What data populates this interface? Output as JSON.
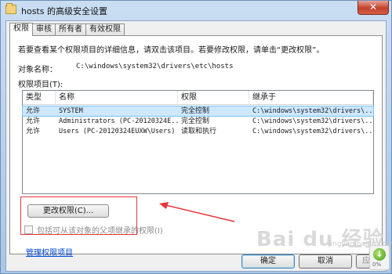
{
  "window": {
    "title": "hosts 的高级安全设置",
    "close_glyph": "✕"
  },
  "tabs": [
    {
      "label": "权限",
      "active": true
    },
    {
      "label": "审核",
      "active": false
    },
    {
      "label": "所有者",
      "active": false
    },
    {
      "label": "有效权限",
      "active": false
    }
  ],
  "panel": {
    "description": "若要查看某个权限项目的详细信息，请双击该项目。若要修改权限，请单击“更改权限”。",
    "object_name_label": "对象名称：",
    "object_name_value": "C:\\windows\\system32\\drivers\\etc\\hosts",
    "permissions_label": "权限项目(T):",
    "columns": [
      "类型",
      "名称",
      "权限",
      "继承于"
    ],
    "rows": [
      {
        "type": "允许",
        "name": "SYSTEM",
        "permission": "完全控制",
        "inherited": "C:\\windows\\system32\\drivers\\...",
        "selected": true
      },
      {
        "type": "允许",
        "name": "Administrators (PC-20120324E...",
        "permission": "完全控制",
        "inherited": "C:\\windows\\system32\\drivers\\...",
        "selected": false
      },
      {
        "type": "允许",
        "name": "Users (PC-20120324EUXW\\Users)",
        "permission": "读取和执行",
        "inherited": "C:\\windows\\system32\\drivers\\...",
        "selected": false
      }
    ],
    "change_button": "更改权限(C)...",
    "inherit_checkbox": "包括可从该对象的父项继承的权限(I)",
    "manage_link": "管理权限项目"
  },
  "buttons": {
    "ok": "确定",
    "cancel": "取消",
    "apply": "应用(A)"
  },
  "watermark": {
    "text": "Bai du 经验",
    "sub": "jingyan.baidu.com"
  },
  "widget": {
    "glyph": "↓",
    "percent": "0%"
  },
  "colors": {
    "annotation": "#e8343a",
    "selection": "#cde8ff",
    "link": "#0046d5"
  }
}
